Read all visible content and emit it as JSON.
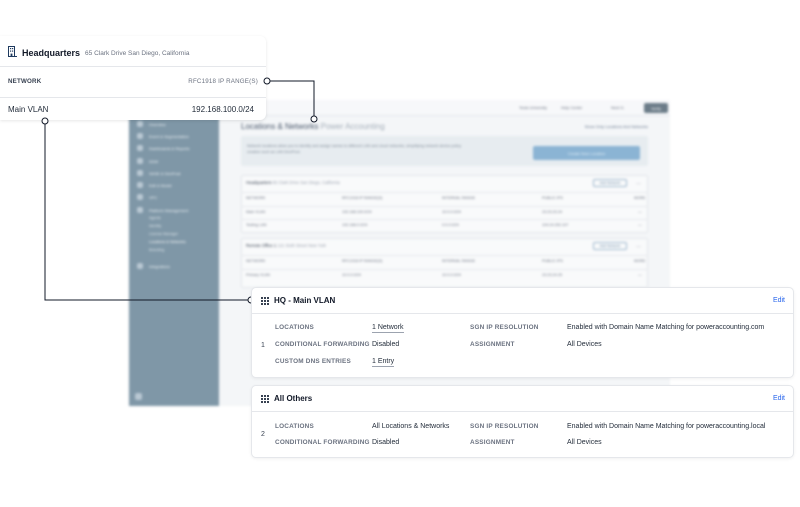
{
  "background_app": {
    "topbar": {
      "org": "Tesla University",
      "help": "Help Center",
      "user": "Nest G.",
      "button": "Verify"
    },
    "sidebar": {
      "items": [
        "Overview",
        "Event & Segmentation",
        "Dashboards & Reports",
        "DDM",
        "SASE & DeviFoal",
        "Edit & Model",
        "VPC",
        "Platform Management",
        "Integrations"
      ],
      "sub_items": [
        "Agents",
        "Identity",
        "License Manager",
        "Locations & Networks",
        "Branding"
      ]
    },
    "page_title": "Locations & Networks",
    "page_title_sub": "Power Accounting",
    "header_link": "Show Only Locations And Networks",
    "description": [
      "Network locations allow you to identify and assign names to different LAN and cloud networks, simplifying network device policy",
      "creation such as LAN DevIPool."
    ],
    "cta_label": "Create New Location",
    "cards": [
      {
        "title": "Headquarters",
        "address": "65 Clark Drive San Diego, California",
        "add_label": "Add Network",
        "columns": [
          "NETWORK",
          "RFC1918 IP RANGE(S)",
          "INTERNAL RANGE",
          "PUBLIC IPS",
          "MORE"
        ],
        "rows": [
          [
            "Main VLAN",
            "192.168.100.0/24",
            "10.0.0.0/24",
            "23.23.23.24",
            "—"
          ],
          [
            "Testing LAN",
            "192.168.0.0/24",
            "0.0.0.0/24",
            "104.24.252.107",
            "—"
          ]
        ]
      },
      {
        "title": "Remote Office 1",
        "address": "121 Sixth Street New York",
        "add_label": "Add Network",
        "columns": [
          "NETWORK",
          "RFC1918 IP RANGE(S)",
          "INTERNAL RANGE",
          "PUBLIC IPS",
          "MORE"
        ],
        "rows": [
          [
            "Primary VLAN",
            "10.0.0.0/24",
            "10.0.0.0/24",
            "23.23.24.25",
            "—"
          ]
        ]
      }
    ]
  },
  "callout": {
    "title": "Headquarters",
    "address": "65 Clark Drive San Diego, California",
    "col_network": "NETWORK",
    "col_range": "RFC1918 IP RANGE(S)",
    "network_name": "Main VLAN",
    "network_range": "192.168.100.0/24"
  },
  "policies": [
    {
      "index": "1",
      "title": "HQ - Main VLAN",
      "edit": "Edit",
      "left": [
        {
          "label": "LOCATIONS",
          "value": "1 Network",
          "link": true
        },
        {
          "label": "CONDITIONAL FORWARDING",
          "value": "Disabled",
          "link": false
        },
        {
          "label": "CUSTOM DNS ENTRIES",
          "value": "1 Entry",
          "link": true
        }
      ],
      "right": [
        {
          "label": "SGN IP RESOLUTION",
          "value": "Enabled with Domain Name Matching for poweraccounting.com"
        },
        {
          "label": "ASSIGNMENT",
          "value": "All Devices"
        }
      ]
    },
    {
      "index": "2",
      "title": "All Others",
      "edit": "Edit",
      "left": [
        {
          "label": "LOCATIONS",
          "value": "All Locations & Networks",
          "link": false
        },
        {
          "label": "CONDITIONAL FORWARDING",
          "value": "Disabled",
          "link": false
        }
      ],
      "right": [
        {
          "label": "SGN IP RESOLUTION",
          "value": "Enabled with Domain Name Matching for poweraccounting.local"
        },
        {
          "label": "ASSIGNMENT",
          "value": "All Devices"
        }
      ]
    }
  ],
  "colors": {
    "accent": "#2563eb",
    "sidebar": "#7f97a7",
    "connector": "#111827"
  },
  "icons": {
    "location": "building-icon",
    "drag": "drag-grip-icon"
  }
}
